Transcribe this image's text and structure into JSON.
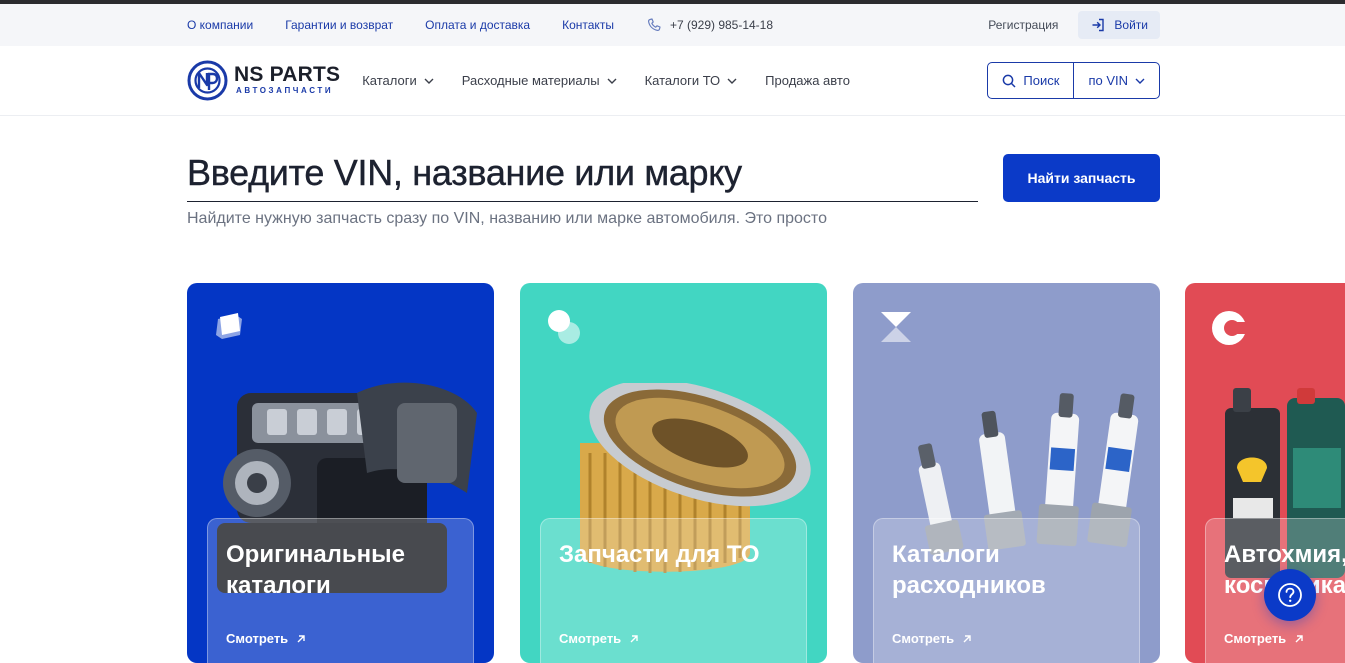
{
  "topbar": {
    "links": [
      "О компании",
      "Гарантии и возврат",
      "Оплата и доставка",
      "Контакты"
    ],
    "phone": "+7 (929) 985-14-18",
    "register": "Регистрация",
    "login": "Войти"
  },
  "nav": {
    "logo_name": "NS PARTS",
    "logo_sub": "АВТОЗАПЧАСТИ",
    "items": [
      {
        "label": "Каталоги",
        "dropdown": true
      },
      {
        "label": "Расходные материалы",
        "dropdown": true
      },
      {
        "label": "Каталоги ТО",
        "dropdown": true
      },
      {
        "label": "Продажа авто",
        "dropdown": false
      }
    ],
    "search_label": "Поиск",
    "search_mode": "по VIN"
  },
  "hero": {
    "placeholder": "Введите VIN, название или марку",
    "subtitle": "Найдите нужную запчасть сразу по VIN, названию или марке автомобиля. Это просто",
    "button": "Найти запчасть"
  },
  "cards": [
    {
      "title": "Оригинальные каталоги",
      "link": "Смотреть",
      "color": "#0436c5"
    },
    {
      "title": "Запчасти для ТО",
      "link": "Смотреть",
      "color": "#42d6c2"
    },
    {
      "title": "Каталоги расходников",
      "link": "Смотреть",
      "color": "#8e9ccb"
    },
    {
      "title": "Автохмия, косметика",
      "link": "Смотреть",
      "color": "#e14b55"
    }
  ],
  "colors": {
    "accent": "#0b3ac8",
    "link": "#1a3aa8"
  },
  "icons": {
    "help": "question-icon",
    "phone": "phone-icon",
    "login": "login-icon",
    "search": "search-icon"
  }
}
